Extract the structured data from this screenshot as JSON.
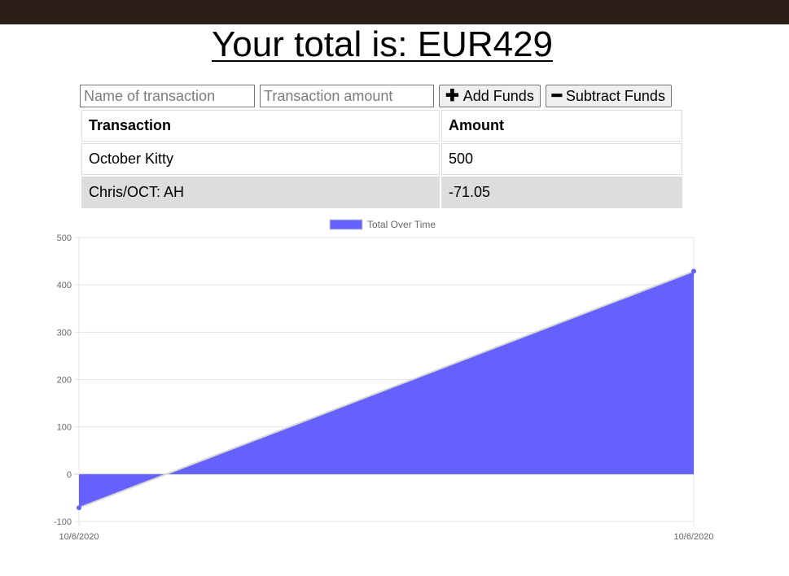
{
  "header": {
    "total_text": "Your total is: EUR429"
  },
  "form": {
    "name_placeholder": "Name of transaction",
    "amount_placeholder": "Transaction amount",
    "add_label": "Add Funds",
    "subtract_label": "Subtract Funds",
    "add_icon": "plus-icon",
    "subtract_icon": "minus-icon"
  },
  "table": {
    "headers": [
      "Transaction",
      "Amount"
    ],
    "rows": [
      {
        "name": "October Kitty",
        "amount": "500"
      },
      {
        "name": "Chris/OCT: AH",
        "amount": "-71.05"
      }
    ]
  },
  "chart_data": {
    "type": "area",
    "x": [
      "10/6/2020",
      "10/6/2020"
    ],
    "series": [
      {
        "name": "Total Over Time",
        "values": [
          -71.05,
          428.95
        ]
      }
    ],
    "ylim": [
      -100,
      500
    ],
    "yticks": [
      500,
      400,
      300,
      200,
      100,
      0,
      -100
    ],
    "grid": true,
    "legend": "top-center",
    "colors": {
      "fill": "#6461fc",
      "point": "#6461fc",
      "line": "#d6d6d6",
      "grid": "#e6e6e6"
    }
  }
}
